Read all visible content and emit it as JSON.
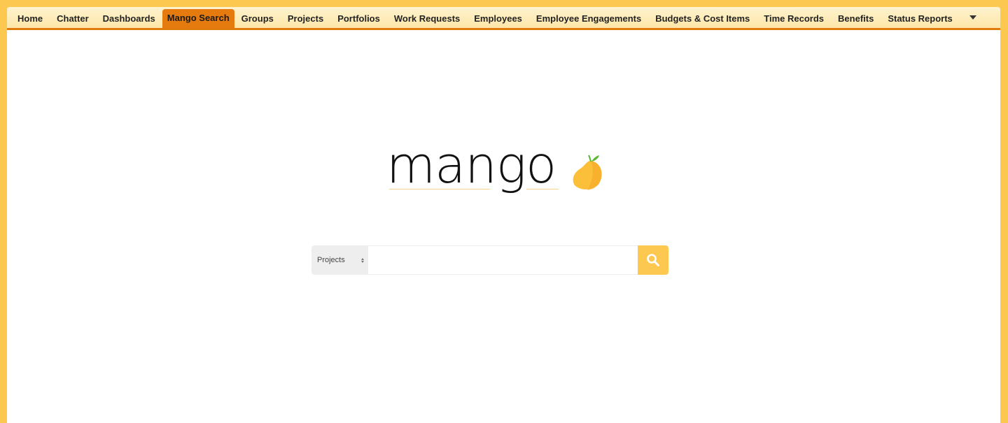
{
  "nav": {
    "tabs": [
      {
        "label": "Home",
        "active": false
      },
      {
        "label": "Chatter",
        "active": false
      },
      {
        "label": "Dashboards",
        "active": false
      },
      {
        "label": "Mango Search",
        "active": true
      },
      {
        "label": "Groups",
        "active": false
      },
      {
        "label": "Projects",
        "active": false
      },
      {
        "label": "Portfolios",
        "active": false
      },
      {
        "label": "Work Requests",
        "active": false
      },
      {
        "label": "Employees",
        "active": false
      },
      {
        "label": "Employee Engagements",
        "active": false
      },
      {
        "label": "Budgets & Cost Items",
        "active": false
      },
      {
        "label": "Time Records",
        "active": false
      },
      {
        "label": "Benefits",
        "active": false
      },
      {
        "label": "Status Reports",
        "active": false
      }
    ],
    "more_icon": "caret-down-icon"
  },
  "logo": {
    "wordmark": "mango",
    "icon": "mango-fruit-icon"
  },
  "search": {
    "scope_selected": "Projects",
    "query_value": "",
    "query_placeholder": "",
    "button_icon": "magnifier-icon"
  },
  "colors": {
    "page_background": "#fdc84f",
    "tab_active": "#e57a0f",
    "tab_bar_border": "#e07a0c",
    "search_button": "#fdc84f",
    "mango_fruit": "#fbbf3a",
    "mango_leaf": "#5cb833"
  }
}
